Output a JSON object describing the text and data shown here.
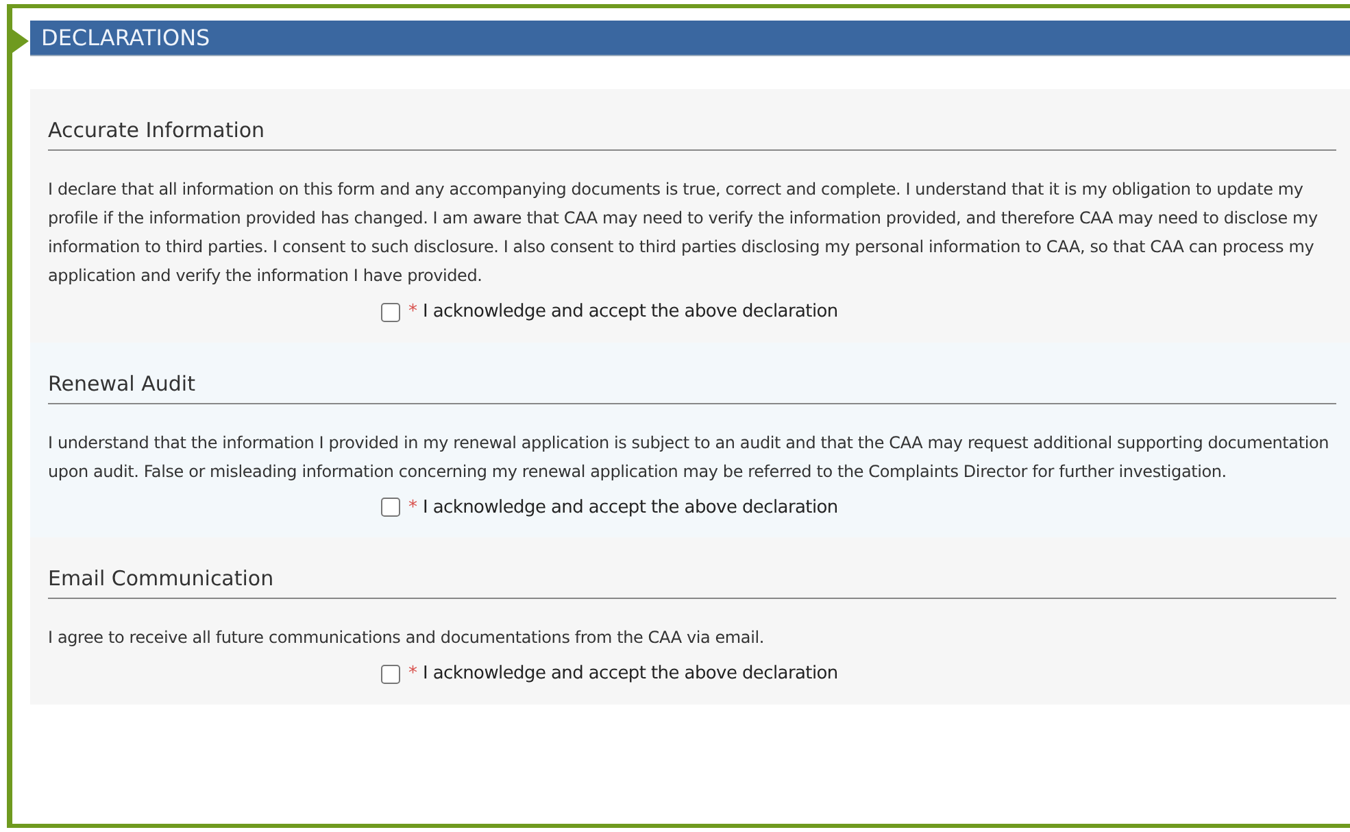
{
  "header": {
    "title": "DECLARATIONS"
  },
  "sections": [
    {
      "heading": "Accurate Information",
      "text": "I declare that all information on this form and any accompanying documents is true, correct and complete. I understand that it is my obligation to update my profile if the information provided has changed. I am aware that CAA may need to verify the information provided, and therefore CAA may need to disclose my information to third parties. I consent to such disclosure. I also consent to third parties disclosing my personal information to CAA, so that CAA can process my application and verify the information I have provided.",
      "required_mark": "*",
      "checkbox_label": "I acknowledge and accept the above declaration",
      "checked": false
    },
    {
      "heading": "Renewal Audit",
      "text": "I understand that the information I provided in my renewal application is subject to an audit and that the CAA may request additional supporting documentation upon audit. False or misleading information concerning my renewal application may be referred to the Complaints Director for further investigation.",
      "required_mark": "*",
      "checkbox_label": "I acknowledge and accept the above declaration",
      "checked": false
    },
    {
      "heading": "Email Communication",
      "text": "I agree to receive all future communications and documentations from the CAA via email.",
      "required_mark": "*",
      "checkbox_label": "I acknowledge and accept the above declaration",
      "checked": false
    }
  ]
}
